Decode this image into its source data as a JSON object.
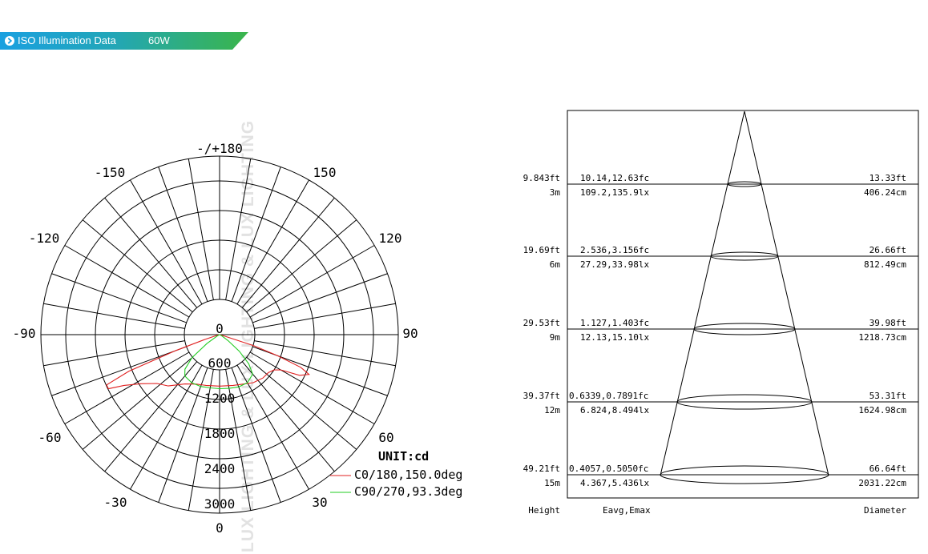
{
  "header": {
    "title": "ISO Illumination  Data",
    "power": "60W",
    "accent_colors": [
      "#1aa0e0",
      "#3ab54a"
    ],
    "icon": "chevron-right-icon"
  },
  "watermark": {
    "text": "LUX LIGHTING & LUX LIGHTING & LUX LIGHTING",
    "color": "#dcdcdc"
  },
  "polar": {
    "angle_labels": [
      {
        "text": "-/+180",
        "angle": 180
      },
      {
        "text": "150",
        "angle": 150
      },
      {
        "text": "-150",
        "angle": -150
      },
      {
        "text": "120",
        "angle": 120
      },
      {
        "text": "-120",
        "angle": -120
      },
      {
        "text": "90",
        "angle": 90
      },
      {
        "text": "-90",
        "angle": -90
      },
      {
        "text": "60",
        "angle": 60
      },
      {
        "text": "-60",
        "angle": -60
      },
      {
        "text": "30",
        "angle": 30
      },
      {
        "text": "-30",
        "angle": -30
      },
      {
        "text": "0",
        "angle": 0
      }
    ],
    "radial_labels": [
      "0",
      "600",
      "1200",
      "1800",
      "2400",
      "3000"
    ],
    "unit": "UNIT:cd",
    "legend": [
      {
        "label": "C0/180,150.0deg",
        "color": "#e02020"
      },
      {
        "label": "C90/270,93.3deg",
        "color": "#22cc22"
      }
    ]
  },
  "chart_data": {
    "type": "polar",
    "unit": "cd",
    "rmax": 3000,
    "radial_ticks": [
      0,
      600,
      1200,
      1800,
      2400,
      3000
    ],
    "series": [
      {
        "name": "C0/180,150.0deg",
        "color": "#e02020",
        "points": [
          [
            -75,
            60
          ],
          [
            -72,
            300
          ],
          [
            -70,
            900
          ],
          [
            -68,
            1900
          ],
          [
            -66,
            2400
          ],
          [
            -64,
            2400
          ],
          [
            -62,
            2100
          ],
          [
            -58,
            1800
          ],
          [
            -52,
            1540
          ],
          [
            -45,
            1410
          ],
          [
            -35,
            1170
          ],
          [
            -25,
            1060
          ],
          [
            -15,
            1020
          ],
          [
            0,
            1000
          ],
          [
            15,
            1020
          ],
          [
            25,
            1060
          ],
          [
            35,
            1140
          ],
          [
            45,
            1190
          ],
          [
            52,
            1200
          ],
          [
            57,
            1260
          ],
          [
            60,
            1370
          ],
          [
            63,
            1740
          ],
          [
            66,
            1900
          ],
          [
            68,
            1700
          ],
          [
            70,
            1200
          ],
          [
            72,
            700
          ],
          [
            75,
            60
          ]
        ]
      },
      {
        "name": "C90/270,93.3deg",
        "color": "#22cc22",
        "points": [
          [
            -60,
            60
          ],
          [
            -55,
            300
          ],
          [
            -50,
            700
          ],
          [
            -45,
            950
          ],
          [
            -40,
            1050
          ],
          [
            -30,
            1080
          ],
          [
            -20,
            1070
          ],
          [
            -10,
            1050
          ],
          [
            0,
            1050
          ],
          [
            10,
            1060
          ],
          [
            20,
            1080
          ],
          [
            30,
            1080
          ],
          [
            40,
            1000
          ],
          [
            45,
            800
          ],
          [
            50,
            500
          ],
          [
            55,
            200
          ],
          [
            60,
            60
          ]
        ]
      }
    ]
  },
  "cone": {
    "rows": [
      {
        "height_ft": "9.843ft",
        "height_m": "3m",
        "eavg_fc": "10.14,12.63fc",
        "eavg_lx": "109.2,135.9lx",
        "diameter_ft": "13.33ft",
        "diameter_cm": "406.24cm"
      },
      {
        "height_ft": "19.69ft",
        "height_m": "6m",
        "eavg_fc": "2.536,3.156fc",
        "eavg_lx": "27.29,33.98lx",
        "diameter_ft": "26.66ft",
        "diameter_cm": "812.49cm"
      },
      {
        "height_ft": "29.53ft",
        "height_m": "9m",
        "eavg_fc": "1.127,1.403fc",
        "eavg_lx": "12.13,15.10lx",
        "diameter_ft": "39.98ft",
        "diameter_cm": "1218.73cm"
      },
      {
        "height_ft": "39.37ft",
        "height_m": "12m",
        "eavg_fc": "0.6339,0.7891fc",
        "eavg_lx": "6.824,8.494lx",
        "diameter_ft": "53.31ft",
        "diameter_cm": "1624.98cm"
      },
      {
        "height_ft": "49.21ft",
        "height_m": "15m",
        "eavg_fc": "0.4057,0.5050fc",
        "eavg_lx": "4.367,5.436lx",
        "diameter_ft": "66.64ft",
        "diameter_cm": "2031.22cm"
      }
    ],
    "footer": {
      "height": "Height",
      "eavg": "Eavg,Emax",
      "diameter": "Diameter"
    }
  }
}
